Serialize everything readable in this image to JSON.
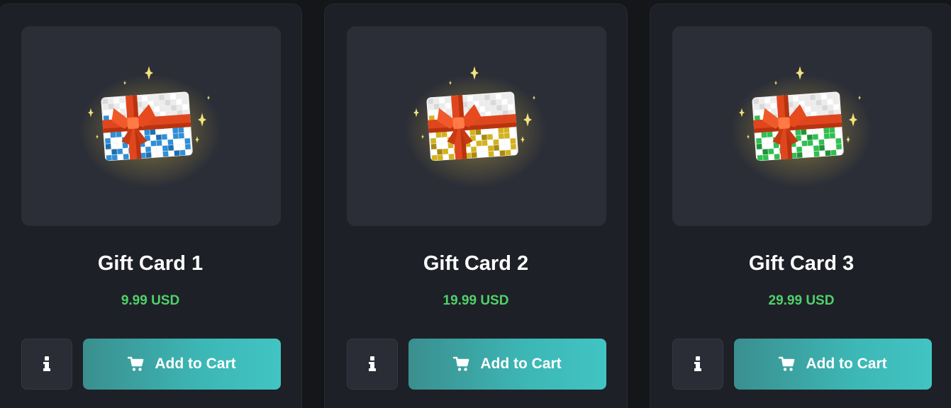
{
  "products": [
    {
      "title": "Gift Card 1",
      "price": "9.99 USD",
      "info_icon": "info-icon",
      "cart_icon": "cart-icon",
      "cart_label": "Add to Cart",
      "card_color": "#2f8fd6",
      "card_color_dark": "#1c6fb0"
    },
    {
      "title": "Gift Card 2",
      "price": "19.99 USD",
      "info_icon": "info-icon",
      "cart_icon": "cart-icon",
      "cart_label": "Add to Cart",
      "card_color": "#d4b21c",
      "card_color_dark": "#a98a10"
    },
    {
      "title": "Gift Card 3",
      "price": "29.99 USD",
      "info_icon": "info-icon",
      "cart_icon": "cart-icon",
      "cart_label": "Add to Cart",
      "card_color": "#2ec050",
      "card_color_dark": "#1d9438"
    }
  ],
  "colors": {
    "background": "#141619",
    "card": "#1e2027",
    "thumb": "#2b2e37",
    "price": "#4fd16a",
    "button_accent": "#3cb7b6",
    "ribbon": "#e0461e",
    "sparkle": "#f3e27a"
  }
}
